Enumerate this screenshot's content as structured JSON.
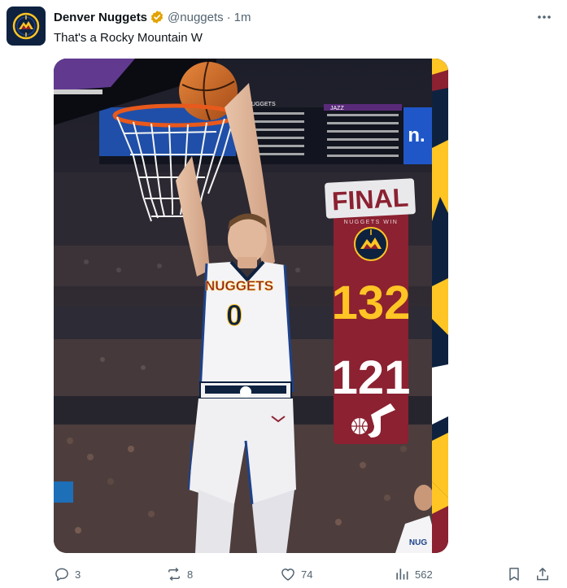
{
  "account": {
    "name": "Denver Nuggets",
    "handle": "@nuggets",
    "separator": "·",
    "time": "1m",
    "verified_color": "#e2a300",
    "avatar_icon": "nuggets-logo-icon"
  },
  "tweet": {
    "text": "That's a Rocky Mountain W"
  },
  "media": {
    "final_label": "FINAL",
    "subtitle": "NUGGETS WIN",
    "home_score": "132",
    "away_score": "121",
    "home_logo": "nuggets-logo-icon",
    "away_logo": "jazz-logo-icon",
    "player_jersey_team": "NUGGETS",
    "player_number": "0",
    "scoreboard_team_home": "NUGGETS",
    "scoreboard_team_away": "JAZZ",
    "colors": {
      "panel_red": "#8b2131",
      "score_gold": "#fec524",
      "navy": "#0e2240",
      "final_white": "#ffffff"
    }
  },
  "actions": {
    "replies": "3",
    "reposts": "8",
    "likes": "74",
    "views": "562"
  }
}
